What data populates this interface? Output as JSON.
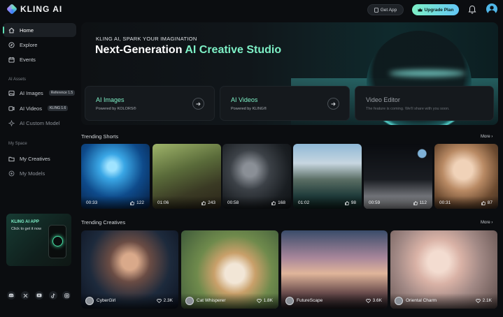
{
  "brand": {
    "name": "KLING AI"
  },
  "topbar": {
    "get_app": "Get App",
    "upgrade": "Upgrade Plan"
  },
  "sidebar": {
    "items": [
      {
        "label": "Home",
        "icon": "home-icon"
      },
      {
        "label": "Explore",
        "icon": "compass-icon"
      },
      {
        "label": "Events",
        "icon": "calendar-icon"
      }
    ],
    "assets_label": "AI Assets",
    "assets": [
      {
        "label": "AI Images",
        "badge": "Reference 1.5",
        "icon": "image-icon"
      },
      {
        "label": "AI Videos",
        "badge": "KLING 1.6",
        "icon": "video-icon"
      },
      {
        "label": "AI Custom Model",
        "icon": "sparkle-icon"
      }
    ],
    "space_label": "My Space",
    "space": [
      {
        "label": "My Creatives",
        "icon": "folder-icon"
      },
      {
        "label": "My Models",
        "icon": "model-icon"
      }
    ],
    "app_card": {
      "title": "KLING AI APP",
      "subtitle": "Click to get it now"
    },
    "social": [
      "discord-icon",
      "x-icon",
      "youtube-icon",
      "tiktok-icon",
      "instagram-icon"
    ]
  },
  "hero": {
    "kicker": "KLING AI, SPARK YOUR IMAGINATION",
    "headline_plain": "Next-Generation ",
    "headline_accent": "AI Creative Studio"
  },
  "features": [
    {
      "title": "AI Images",
      "subtitle": "Powered by KOLORS®"
    },
    {
      "title": "AI Videos",
      "subtitle": "Powered by KLING®"
    },
    {
      "title": "Video Editor",
      "subtitle": "The feature is coming. We'll share with you soon."
    }
  ],
  "trending_shorts": {
    "title": "Trending Shorts",
    "more": "More",
    "items": [
      {
        "duration": "00:33",
        "likes": "122"
      },
      {
        "duration": "01:06",
        "likes": "243"
      },
      {
        "duration": "00:58",
        "likes": "168"
      },
      {
        "duration": "01:02",
        "likes": "98"
      },
      {
        "duration": "00:59",
        "likes": "112"
      },
      {
        "duration": "00:31",
        "likes": "87"
      }
    ]
  },
  "trending_creatives": {
    "title": "Trending Creatives",
    "more": "More",
    "items": [
      {
        "author": "CyberGirl",
        "likes": "2.3K"
      },
      {
        "author": "Cat Whisperer",
        "likes": "1.8K"
      },
      {
        "author": "FutureScape",
        "likes": "3.6K"
      },
      {
        "author": "Oriental Charm",
        "likes": "2.1K"
      }
    ]
  },
  "colors": {
    "accent": "#7ef0c6",
    "background": "#0b0d10",
    "card": "#15191d"
  }
}
